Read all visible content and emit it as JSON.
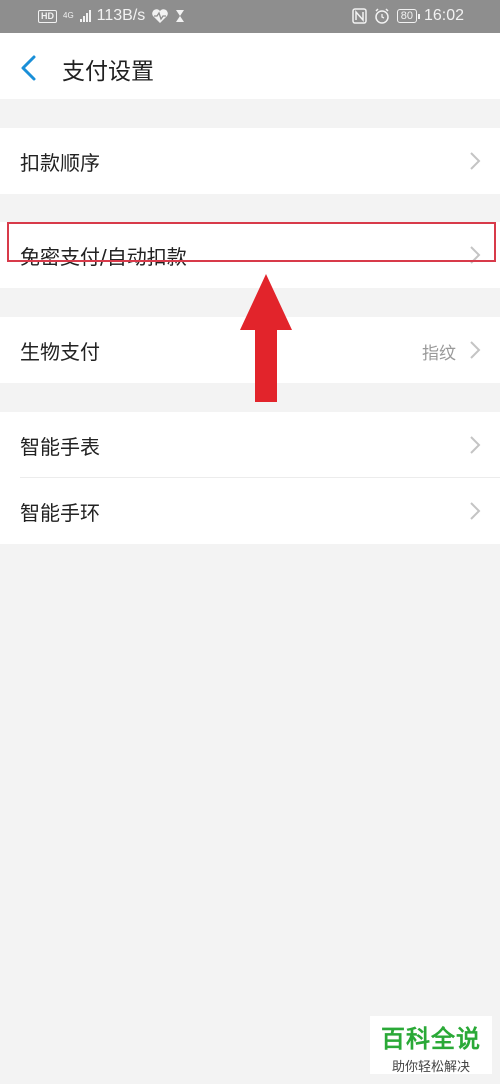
{
  "status_bar": {
    "hd": "HD",
    "network": "4G",
    "speed": "113B/s",
    "battery": "80",
    "time": "16:02",
    "icons": [
      "signal-icon",
      "heart-rate-icon",
      "hourglass-icon",
      "nfc-icon",
      "alarm-icon",
      "battery-icon"
    ]
  },
  "header": {
    "title": "支付设置",
    "back_icon": "chevron-left-icon",
    "accent_color": "#1a8fd8"
  },
  "settings": {
    "items": [
      {
        "label": "扣款顺序"
      },
      {
        "label": "免密支付/自动扣款"
      },
      {
        "label": "生物支付",
        "value": "指纹"
      },
      {
        "label": "智能手表"
      },
      {
        "label": "智能手环"
      }
    ]
  },
  "annotation": {
    "highlight_color": "#d83a4a",
    "arrow_color": "#e2242b"
  },
  "watermark": {
    "title": "百科全说",
    "subtitle": "助你轻松解决"
  }
}
